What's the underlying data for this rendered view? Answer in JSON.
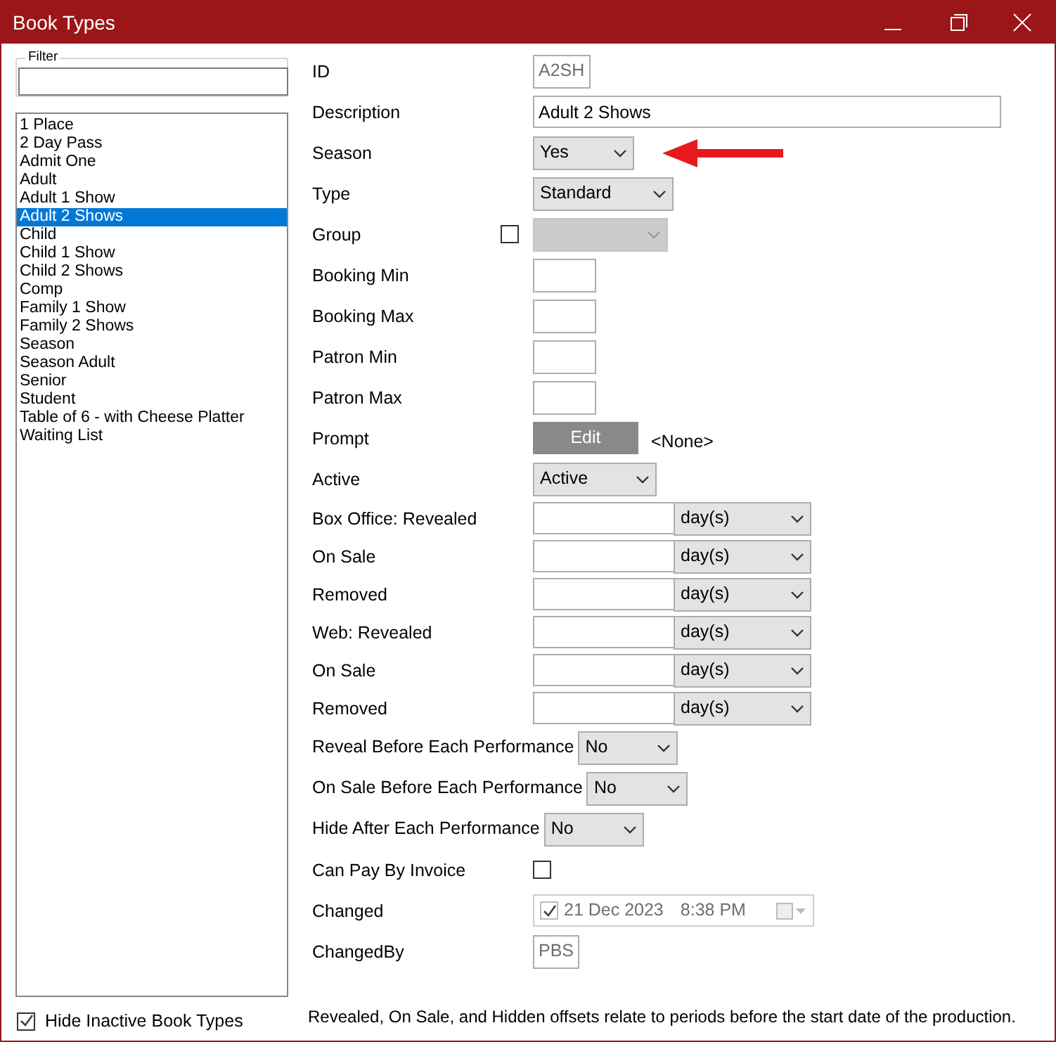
{
  "window": {
    "title": "Book Types"
  },
  "filter": {
    "legend": "Filter"
  },
  "list": [
    {
      "label": "1 Place",
      "selected": false
    },
    {
      "label": "2 Day Pass",
      "selected": false
    },
    {
      "label": "Admit One",
      "selected": false
    },
    {
      "label": "Adult",
      "selected": false
    },
    {
      "label": "Adult 1 Show",
      "selected": false
    },
    {
      "label": "Adult 2 Shows",
      "selected": true
    },
    {
      "label": "Child",
      "selected": false
    },
    {
      "label": "Child 1 Show",
      "selected": false
    },
    {
      "label": "Child 2 Shows",
      "selected": false
    },
    {
      "label": "Comp",
      "selected": false
    },
    {
      "label": "Family 1 Show",
      "selected": false
    },
    {
      "label": "Family 2 Shows",
      "selected": false
    },
    {
      "label": "Season",
      "selected": false
    },
    {
      "label": "Season Adult",
      "selected": false
    },
    {
      "label": "Senior",
      "selected": false
    },
    {
      "label": "Student",
      "selected": false
    },
    {
      "label": "Table of 6 - with Cheese Platter",
      "selected": false
    },
    {
      "label": "Waiting List",
      "selected": false
    }
  ],
  "hide_inactive": {
    "label": "Hide Inactive Book Types",
    "checked": true
  },
  "form": [
    {
      "kind": "readonly",
      "label": "ID",
      "value": "A2SH"
    },
    {
      "kind": "wide",
      "label": "Description",
      "value": "Adult 2 Shows"
    },
    {
      "kind": "select",
      "label": "Season",
      "value": "Yes",
      "arrow": true
    },
    {
      "kind": "select",
      "label": "Type",
      "value": "Standard"
    },
    {
      "kind": "check_select",
      "label": "Group",
      "checked": false,
      "disabled": true
    },
    {
      "kind": "number",
      "label": "Booking Min"
    },
    {
      "kind": "number",
      "label": "Booking Max"
    },
    {
      "kind": "number",
      "label": "Patron Min"
    },
    {
      "kind": "number",
      "label": "Patron Max"
    },
    {
      "kind": "button",
      "label": "Prompt",
      "button": "Edit",
      "note": "<None>"
    },
    {
      "kind": "select",
      "label": "Active",
      "value": "Active"
    },
    {
      "kind": "offset",
      "label": "Box Office: Revealed",
      "unit": "day(s)"
    },
    {
      "kind": "offset",
      "label": "On Sale",
      "unit": "day(s)"
    },
    {
      "kind": "offset",
      "label": "Removed",
      "unit": "day(s)"
    },
    {
      "kind": "offset",
      "label": "Web: Revealed",
      "unit": "day(s)"
    },
    {
      "kind": "offset",
      "label": "On Sale",
      "unit": "day(s)"
    },
    {
      "kind": "offset",
      "label": "Removed",
      "unit": "day(s)"
    },
    {
      "kind": "inline_select",
      "label": "Reveal Before Each Performance",
      "value": "No"
    },
    {
      "kind": "inline_select",
      "label": "On Sale Before Each Performance",
      "value": "No"
    },
    {
      "kind": "inline_select",
      "label": "Hide After Each Performance",
      "value": "No"
    },
    {
      "kind": "checkbox",
      "label": "Can Pay By Invoice",
      "checked": false
    },
    {
      "kind": "datetime",
      "label": "Changed",
      "checked": true,
      "date": "21 Dec 2023",
      "time": "8:38 PM"
    },
    {
      "kind": "readonly",
      "label": "ChangedBy",
      "value": "PBS"
    }
  ],
  "footer": "Revealed, On Sale, and Hidden offsets relate to periods before the start date of the production."
}
